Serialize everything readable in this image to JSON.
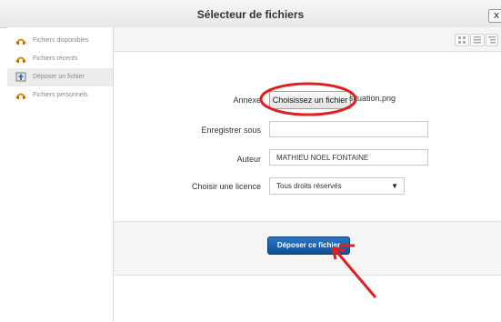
{
  "window": {
    "title": "Sélecteur de fichiers",
    "close_glyph": "x"
  },
  "sidebar": {
    "items": [
      {
        "label": "Fichiers disponibles",
        "icon": "repository-icon",
        "active": false
      },
      {
        "label": "Fichiers récents",
        "icon": "repository-icon",
        "active": false
      },
      {
        "label": "Déposer un fichier",
        "icon": "upload-icon",
        "active": true
      },
      {
        "label": "Fichiers personnels",
        "icon": "repository-icon",
        "active": false
      }
    ]
  },
  "toolbar": {
    "views": [
      "grid-view-icon",
      "list-view-icon",
      "tree-view-icon"
    ]
  },
  "form": {
    "attachment_label": "Annexe",
    "choose_file_button": "Choisissez un fichier",
    "chosen_file_name": "situation.png",
    "save_as_label": "Enregistrer sous",
    "save_as_value": "",
    "author_label": "Auteur",
    "author_value": "MATHIEU NOEL FONTAINE",
    "license_label": "Choisir une licence",
    "license_value": "Tous droits réservés"
  },
  "footer": {
    "submit_button": "Déposer ce fichier"
  },
  "annotation_color": "#e02020"
}
